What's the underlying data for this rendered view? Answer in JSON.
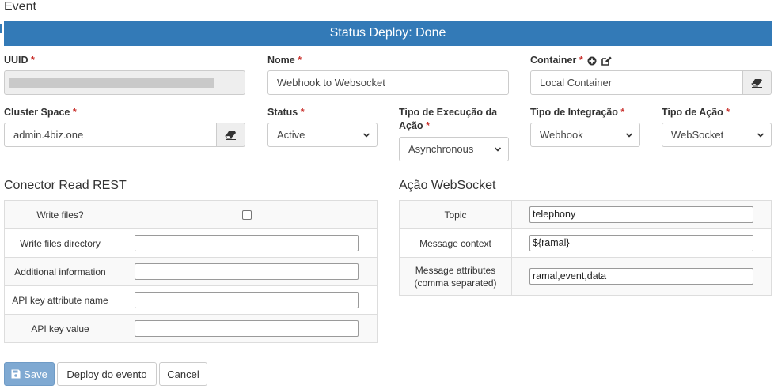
{
  "page": {
    "title": "Event"
  },
  "status": {
    "text": "Status Deploy: Done"
  },
  "form": {
    "uuid": {
      "label": "UUID",
      "value": ""
    },
    "nome": {
      "label": "Nome",
      "value": "Webhook to Websocket"
    },
    "container": {
      "label": "Container",
      "value": "Local Container"
    },
    "cluster_space": {
      "label": "Cluster Space",
      "value": "admin.4biz.one"
    },
    "status": {
      "label": "Status",
      "value": "Active"
    },
    "tipo_execucao": {
      "label_line1": "Tipo de Execução da",
      "label_line2": "Ação",
      "value": "Asynchronous"
    },
    "tipo_integracao": {
      "label": "Tipo de Integração",
      "value": "Webhook"
    },
    "tipo_acao": {
      "label": "Tipo de Ação",
      "value": "WebSocket"
    },
    "required_mark": "*"
  },
  "connector": {
    "title": "Conector Read REST",
    "rows": [
      {
        "key": "Write files?",
        "type": "checkbox",
        "value": ""
      },
      {
        "key": "Write files directory",
        "type": "text",
        "value": ""
      },
      {
        "key": "Additional information",
        "type": "text",
        "value": ""
      },
      {
        "key": "API key attribute name",
        "type": "text",
        "value": ""
      },
      {
        "key": "API key value",
        "type": "text",
        "value": ""
      }
    ]
  },
  "action": {
    "title": "Ação WebSocket",
    "rows": [
      {
        "key": "Topic",
        "value": "telephony"
      },
      {
        "key": "Message context",
        "value": "${ramal}"
      },
      {
        "key_line1": "Message attributes",
        "key_line2": "(comma separated)",
        "value": "ramal,event,data"
      }
    ]
  },
  "buttons": {
    "save": "Save",
    "deploy": "Deploy do evento",
    "cancel": "Cancel"
  },
  "icons": {
    "add": "plus-circle-icon",
    "edit": "edit-icon",
    "eraser": "eraser-icon",
    "caret": "chevron-down-icon",
    "save": "floppy-disk-icon"
  },
  "colors": {
    "primary": "#337ab7",
    "required": "#c9302c",
    "save_button": "#7fa9d2"
  }
}
